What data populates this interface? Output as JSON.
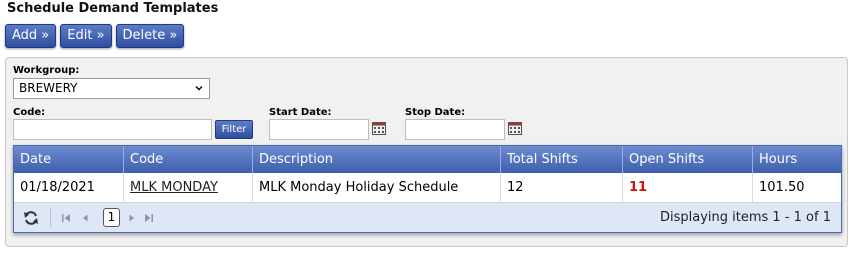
{
  "page_title": "Schedule Demand Templates",
  "toolbar": {
    "add_label": "Add »",
    "edit_label": "Edit »",
    "delete_label": "Delete »"
  },
  "filters": {
    "workgroup_label": "Workgroup:",
    "workgroup_value": "BREWERY",
    "code_label": "Code:",
    "code_value": "",
    "filter_label": "Filter",
    "start_date_label": "Start Date:",
    "start_date_value": "",
    "stop_date_label": "Stop Date:",
    "stop_date_value": ""
  },
  "grid": {
    "columns": [
      "Date",
      "Code",
      "Description",
      "Total Shifts",
      "Open Shifts",
      "Hours"
    ],
    "rows": [
      {
        "date": "01/18/2021",
        "code": "MLK MONDAY",
        "description": "MLK Monday Holiday Schedule",
        "total_shifts": "12",
        "open_shifts": "11",
        "hours": "101.50"
      }
    ],
    "pager": {
      "current_page": "1",
      "info": "Displaying items 1 - 1 of 1"
    }
  },
  "colors": {
    "button_blue": "#2e4ea0",
    "header_blue": "#4b69b0",
    "open_shift_red": "#d01010"
  },
  "icons": [
    "refresh-icon",
    "first-page-icon",
    "prev-page-icon",
    "next-page-icon",
    "last-page-icon",
    "calendar-icon",
    "chevron-down-icon"
  ]
}
